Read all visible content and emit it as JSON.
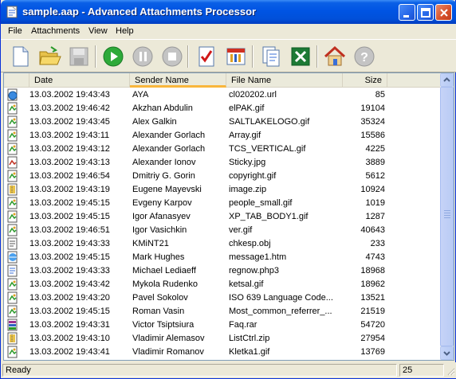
{
  "window": {
    "title": "sample.aap - Advanced Attachments Processor"
  },
  "menu": [
    "File",
    "Attachments",
    "View",
    "Help"
  ],
  "toolbar": [
    {
      "icon": "new-document-icon"
    },
    {
      "icon": "open-folder-icon"
    },
    {
      "icon": "save-icon"
    },
    {
      "icon": "play-icon"
    },
    {
      "icon": "pause-icon"
    },
    {
      "icon": "stop-icon"
    },
    {
      "icon": "checklist-icon"
    },
    {
      "icon": "calendar-icon"
    },
    {
      "icon": "copy-documents-icon"
    },
    {
      "icon": "excel-icon"
    },
    {
      "icon": "home-icon"
    },
    {
      "icon": "help-icon"
    }
  ],
  "columns": {
    "date": "Date",
    "sender": "Sender Name",
    "file": "File Name",
    "size": "Size"
  },
  "rows": [
    {
      "icon": "url-file-icon",
      "date": "13.03.2002 19:43:43",
      "sender": "AYA",
      "file": "cl020202.url",
      "size": "85"
    },
    {
      "icon": "gif-file-icon",
      "date": "13.03.2002 19:46:42",
      "sender": "Akzhan Abdulin",
      "file": "elPAK.gif",
      "size": "19104"
    },
    {
      "icon": "gif-file-icon",
      "date": "13.03.2002 19:43:45",
      "sender": "Alex Galkin",
      "file": "SALTLAKELOGO.gif",
      "size": "35324"
    },
    {
      "icon": "gif-file-icon",
      "date": "13.03.2002 19:43:11",
      "sender": "Alexander Gorlach",
      "file": "Array.gif",
      "size": "15586"
    },
    {
      "icon": "gif-file-icon",
      "date": "13.03.2002 19:43:12",
      "sender": "Alexander Gorlach",
      "file": "TCS_VERTICAL.gif",
      "size": "4225"
    },
    {
      "icon": "jpg-file-icon",
      "date": "13.03.2002 19:43:13",
      "sender": "Alexander Ionov",
      "file": "Sticky.jpg",
      "size": "3889"
    },
    {
      "icon": "gif-file-icon",
      "date": "13.03.2002 19:46:54",
      "sender": "Dmitriy G. Gorin",
      "file": "copyright.gif",
      "size": "5612"
    },
    {
      "icon": "zip-file-icon",
      "date": "13.03.2002 19:43:19",
      "sender": "Eugene Mayevski",
      "file": "image.zip",
      "size": "10924"
    },
    {
      "icon": "gif-file-icon",
      "date": "13.03.2002 19:45:15",
      "sender": "Evgeny Karpov",
      "file": "people_small.gif",
      "size": "1019"
    },
    {
      "icon": "gif-file-icon",
      "date": "13.03.2002 19:45:15",
      "sender": "Igor Afanasyev",
      "file": "XP_TAB_BODY1.gif",
      "size": "1287"
    },
    {
      "icon": "gif-file-icon",
      "date": "13.03.2002 19:46:51",
      "sender": "Igor Vasichkin",
      "file": "ver.gif",
      "size": "40643"
    },
    {
      "icon": "obj-file-icon",
      "date": "13.03.2002 19:43:33",
      "sender": "KMiNT21",
      "file": "chkesp.obj",
      "size": "233"
    },
    {
      "icon": "htm-file-icon",
      "date": "13.03.2002 19:45:15",
      "sender": "Mark Hughes",
      "file": "message1.htm",
      "size": "4743"
    },
    {
      "icon": "php-file-icon",
      "date": "13.03.2002 19:43:33",
      "sender": "Michael Lediaeff",
      "file": "regnow.php3",
      "size": "18968"
    },
    {
      "icon": "gif-file-icon",
      "date": "13.03.2002 19:43:42",
      "sender": "Mykola Rudenko",
      "file": "ketsal.gif",
      "size": "18962"
    },
    {
      "icon": "gif-file-icon",
      "date": "13.03.2002 19:43:20",
      "sender": "Pavel Sokolov",
      "file": "ISO 639 Language Code...",
      "size": "13521"
    },
    {
      "icon": "gif-file-icon",
      "date": "13.03.2002 19:45:15",
      "sender": "Roman Vasin",
      "file": "Most_common_referrer_...",
      "size": "21519"
    },
    {
      "icon": "rar-file-icon",
      "date": "13.03.2002 19:43:31",
      "sender": "Victor Tsiptsiura",
      "file": "Faq.rar",
      "size": "54720"
    },
    {
      "icon": "zip-file-icon",
      "date": "13.03.2002 19:43:10",
      "sender": "Vladimir Alemasov",
      "file": "ListCtrl.zip",
      "size": "27954"
    },
    {
      "icon": "gif-file-icon",
      "date": "13.03.2002 19:43:41",
      "sender": "Vladimir Romanov",
      "file": "Kletka1.gif",
      "size": "13769"
    }
  ],
  "status": {
    "text": "Ready",
    "count": "25"
  },
  "colors": {
    "titlebar": "#0054e3",
    "sort_indicator": "#f9b63c",
    "window_bg": "#ece9d8"
  }
}
